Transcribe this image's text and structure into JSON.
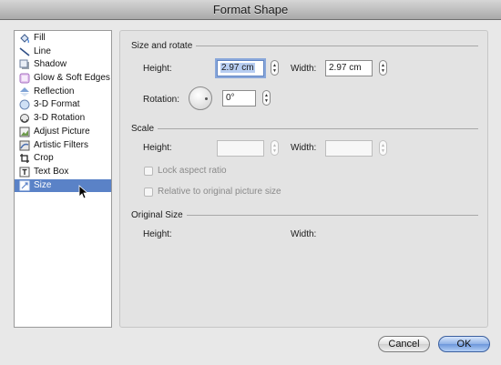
{
  "window": {
    "title": "Format Shape"
  },
  "sidebar": {
    "items": [
      {
        "label": "Fill",
        "icon": "paint-bucket-icon"
      },
      {
        "label": "Line",
        "icon": "line-pen-icon"
      },
      {
        "label": "Shadow",
        "icon": "shadow-icon"
      },
      {
        "label": "Glow & Soft Edges",
        "icon": "glow-icon"
      },
      {
        "label": "Reflection",
        "icon": "reflection-icon"
      },
      {
        "label": "3-D Format",
        "icon": "3d-format-icon"
      },
      {
        "label": "3-D Rotation",
        "icon": "3d-rotation-icon"
      },
      {
        "label": "Adjust Picture",
        "icon": "adjust-picture-icon"
      },
      {
        "label": "Artistic Filters",
        "icon": "artistic-filters-icon"
      },
      {
        "label": "Crop",
        "icon": "crop-icon"
      },
      {
        "label": "Text Box",
        "icon": "text-box-icon"
      },
      {
        "label": "Size",
        "icon": "size-icon",
        "selected": true
      }
    ]
  },
  "size_and_rotate": {
    "heading": "Size and rotate",
    "height_label": "Height:",
    "height_value": "2.97 cm",
    "width_label": "Width:",
    "width_value": "2.97 cm",
    "rotation_label": "Rotation:",
    "rotation_value": "0°"
  },
  "scale": {
    "heading": "Scale",
    "height_label": "Height:",
    "height_value": "",
    "width_label": "Width:",
    "width_value": "",
    "lock_aspect_label": "Lock aspect ratio",
    "lock_aspect_checked": false,
    "relative_label": "Relative to original picture size",
    "relative_checked": false
  },
  "original_size": {
    "heading": "Original Size",
    "height_label": "Height:",
    "width_label": "Width:"
  },
  "buttons": {
    "cancel": "Cancel",
    "ok": "OK"
  },
  "colors": {
    "selection": "#5a82c7",
    "default_button": "#6d97db"
  }
}
